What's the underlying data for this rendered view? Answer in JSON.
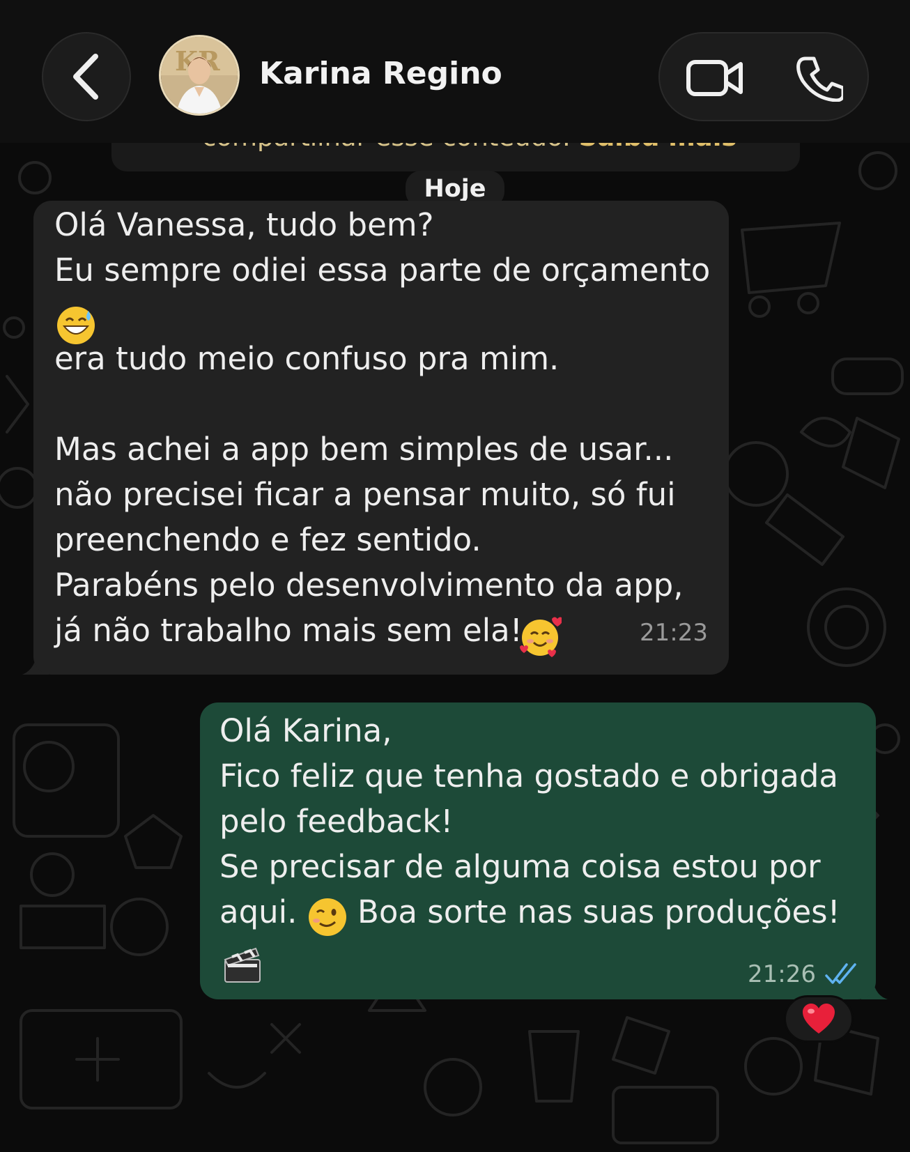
{
  "header": {
    "contact_name": "Karina Regino",
    "back_icon": "chevron-left-icon",
    "video_icon": "video-call-icon",
    "phone_icon": "phone-icon"
  },
  "notice": {
    "text": "compartilhar esse conteúdo.",
    "link": "Saiba mais"
  },
  "date_chip": "Hoje",
  "incoming": {
    "lines": [
      "Olá Vanessa, tudo bem?",
      "Eu sempre odiei essa parte de orçamento",
      "era tudo meio confuso pra mim.",
      "Mas achei a app bem simples de usar...",
      "não precisei ficar a pensar muito, só fui",
      "preenchendo e fez sentido.",
      "Parabéns pelo desenvolvimento da app,",
      "já não trabalho mais sem ela!"
    ],
    "emojis": [
      "grinning-sweat-emoji",
      "smiling-hearts-emoji"
    ],
    "time": "21:23"
  },
  "outgoing": {
    "lines": [
      "Olá Karina,",
      "Fico feliz que tenha gostado e obrigada",
      "pelo feedback!",
      "Se precisar de alguma coisa estou por",
      "aqui.",
      "Boa sorte nas suas produções!"
    ],
    "emojis": [
      "winking-face-emoji",
      "clapper-board-emoji"
    ],
    "time": "21:26",
    "status_icon": "double-check-read-icon",
    "reaction": "red-heart-emoji"
  },
  "colors": {
    "background": "#0b0b0b",
    "incoming_bubble": "#222222",
    "outgoing_bubble": "#1d4a38",
    "read_ticks": "#5fb3f0",
    "notice_link": "#e0bf6a"
  }
}
